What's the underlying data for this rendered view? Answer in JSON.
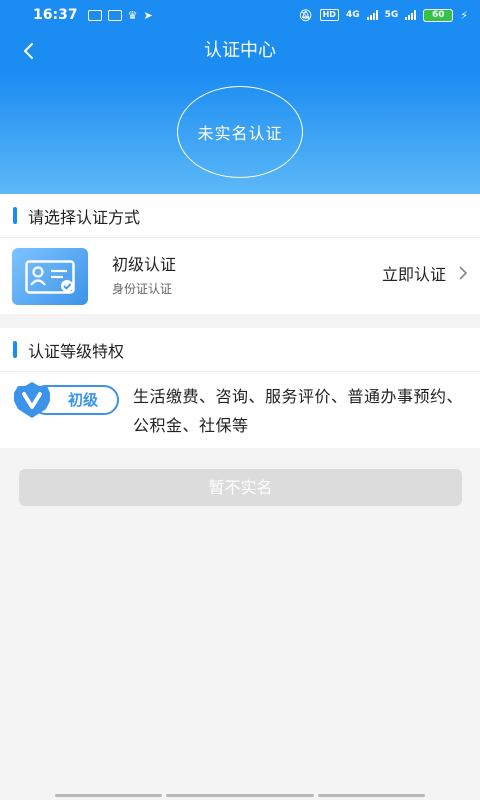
{
  "status_bar": {
    "time": "16:37",
    "network_a": "4G",
    "network_b": "5G",
    "hd": "HD",
    "battery": "60"
  },
  "nav": {
    "title": "认证中心"
  },
  "hero": {
    "status_text": "未实名认证"
  },
  "methods_section": {
    "title": "请选择认证方式",
    "items": [
      {
        "title": "初级认证",
        "subtitle": "身份证认证",
        "action": "立即认证",
        "icon": "id-card-icon"
      }
    ]
  },
  "privileges_section": {
    "title": "认证等级特权",
    "badge_label": "初级",
    "description": "生活缴费、咨询、服务评价、普通办事预约、公积金、社保等"
  },
  "skip_button": {
    "label": "暂不实名"
  },
  "colors": {
    "brand": "#1a8cf2",
    "disabled_button": "#dcdcdc"
  }
}
